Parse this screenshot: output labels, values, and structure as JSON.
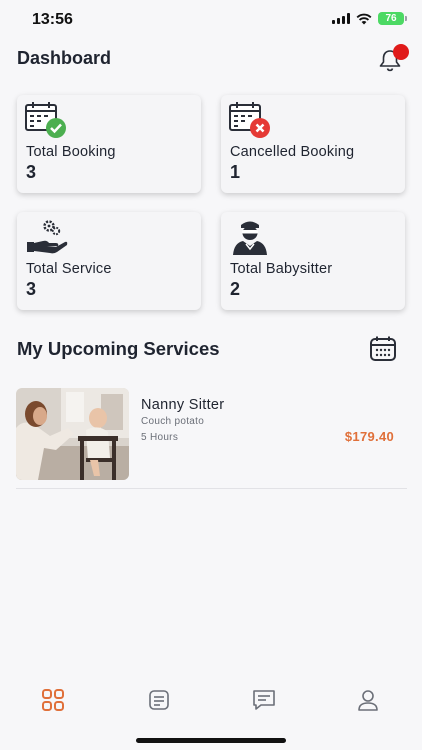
{
  "status_bar": {
    "time": "13:56",
    "battery": "76"
  },
  "header": {
    "title": "Dashboard",
    "notification_icon": "bell-icon",
    "badge_color": "#e01a1a"
  },
  "stats": [
    {
      "label": "Total Booking",
      "count": "3",
      "icon": "calendar-check-icon"
    },
    {
      "label": "Cancelled Booking",
      "count": "1",
      "icon": "calendar-cancel-icon"
    },
    {
      "label": "Total Service",
      "count": "3",
      "icon": "hand-gears-icon"
    },
    {
      "label": "Total Babysitter",
      "count": "2",
      "icon": "person-icon"
    }
  ],
  "upcoming": {
    "title": "My Upcoming Services",
    "calendar_icon": "calendar-icon",
    "services": [
      {
        "name": "Nanny Sitter",
        "subtitle": "Couch potato",
        "duration": "5 Hours",
        "price": "$179.40"
      }
    ]
  },
  "colors": {
    "accent": "#e0703a",
    "check_green": "#4caf50",
    "cancel_red": "#e53935"
  },
  "bottom_nav": [
    {
      "name": "dashboard",
      "icon": "grid-icon",
      "active": true
    },
    {
      "name": "bookings",
      "icon": "document-icon",
      "active": false
    },
    {
      "name": "messages",
      "icon": "chat-icon",
      "active": false
    },
    {
      "name": "profile",
      "icon": "user-icon",
      "active": false
    }
  ]
}
